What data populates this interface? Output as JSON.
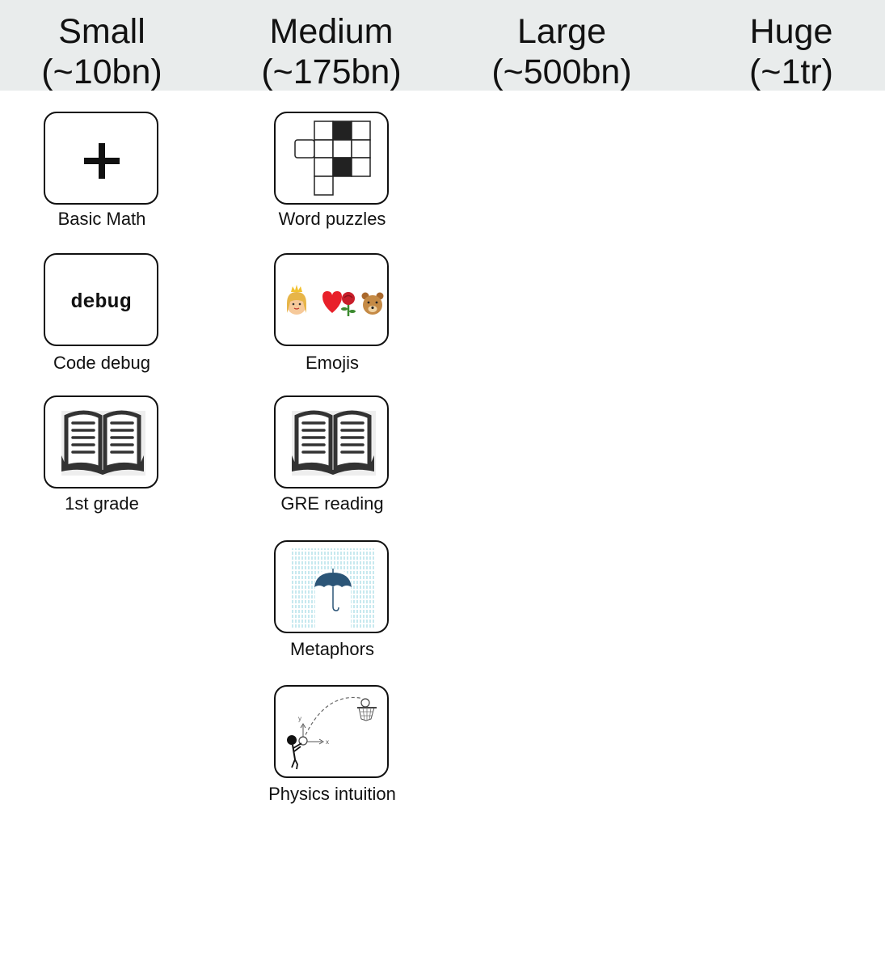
{
  "columns": [
    {
      "name": "Small",
      "size": "(~10bn)"
    },
    {
      "name": "Medium",
      "size": "(~175bn)"
    },
    {
      "name": "Large",
      "size": "(~500bn)"
    },
    {
      "name": "Huge",
      "size": "(~1tr)"
    }
  ],
  "small": {
    "basic_math": "Basic Math",
    "code_debug": "Code debug",
    "code_text": "debug",
    "first_grade": "1st grade"
  },
  "medium": {
    "word_puzzles": "Word puzzles",
    "emojis": "Emojis",
    "gre_reading": "GRE reading",
    "metaphors": "Metaphors",
    "physics_intuition": "Physics intuition",
    "axis_x": "x",
    "axis_y": "y"
  },
  "icons": {
    "basic_math": "plus-icon",
    "code_debug": "code-text-icon",
    "first_grade": "open-book-icon",
    "word_puzzles": "crossword-icon",
    "emojis": "emoji-sequence-icon",
    "gre_reading": "open-book-icon",
    "metaphors": "umbrella-rain-icon",
    "physics_intuition": "basketball-trajectory-icon"
  },
  "colors": {
    "header_bg": "#e9ecec",
    "rain": "#8fd3df",
    "umbrella": "#2c5577"
  }
}
